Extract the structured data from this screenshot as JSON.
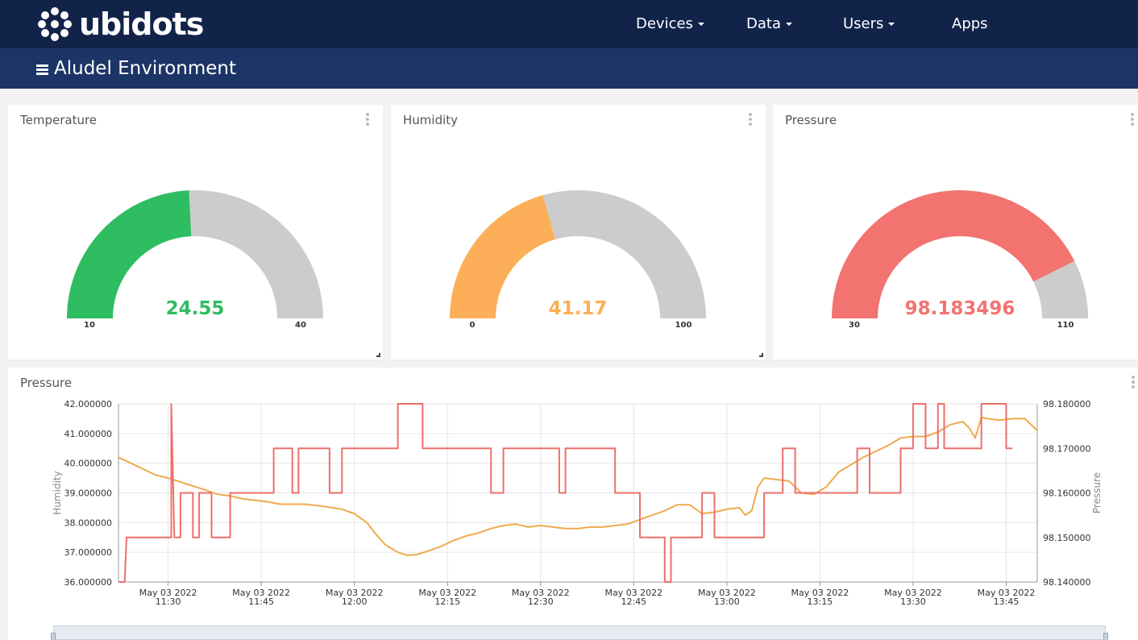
{
  "app": {
    "brand": "ubidots",
    "nav": [
      {
        "label": "Devices",
        "has_menu": true
      },
      {
        "label": "Data",
        "has_menu": true
      },
      {
        "label": "Users",
        "has_menu": true
      },
      {
        "label": "Apps",
        "has_menu": false
      }
    ],
    "dashboard_title": "Aludel Environment"
  },
  "colors": {
    "navbar": "#12234a",
    "subheader": "#1c3566",
    "temperature": "#2ebd60",
    "humidity": "#fcaf58",
    "pressure": "#f27370",
    "gauge_track": "#cccccc"
  },
  "gauges": [
    {
      "title": "Temperature",
      "value": "24.55",
      "value_num": 24.55,
      "min": "10",
      "max": "40",
      "min_num": 10,
      "max_num": 40,
      "color": "#2ebd60"
    },
    {
      "title": "Humidity",
      "value": "41.17",
      "value_num": 41.17,
      "min": "0",
      "max": "100",
      "min_num": 0,
      "max_num": 100,
      "color": "#fcaf58"
    },
    {
      "title": "Pressure",
      "value": "98.183496",
      "value_num": 98.183496,
      "min": "30",
      "max": "110",
      "min_num": 30,
      "max_num": 110,
      "color": "#f27370"
    }
  ],
  "chart_data": {
    "type": "line",
    "title": "Pressure",
    "ylabel_left": "Humidity",
    "ylabel_right": "Pressure",
    "y_left_range": [
      36,
      42
    ],
    "y_right_range": [
      98.14,
      98.18
    ],
    "y_left_ticks": [
      "42.000000",
      "41.000000",
      "40.000000",
      "39.000000",
      "38.000000",
      "37.000000",
      "36.000000"
    ],
    "y_right_ticks": [
      "98.180000",
      "98.170000",
      "98.160000",
      "98.150000",
      "98.140000"
    ],
    "x_range_minutes": [
      682,
      830
    ],
    "x_ticks": [
      {
        "date": "May 03 2022",
        "time": "11:30",
        "minutes": 690
      },
      {
        "date": "May 03 2022",
        "time": "11:45",
        "minutes": 705
      },
      {
        "date": "May 03 2022",
        "time": "12:00",
        "minutes": 720
      },
      {
        "date": "May 03 2022",
        "time": "12:15",
        "minutes": 735
      },
      {
        "date": "May 03 2022",
        "time": "12:30",
        "minutes": 750
      },
      {
        "date": "May 03 2022",
        "time": "12:45",
        "minutes": 765
      },
      {
        "date": "May 03 2022",
        "time": "13:00",
        "minutes": 780
      },
      {
        "date": "May 03 2022",
        "time": "13:15",
        "minutes": 795
      },
      {
        "date": "May 03 2022",
        "time": "13:30",
        "minutes": 810
      },
      {
        "date": "May 03 2022",
        "time": "13:45",
        "minutes": 825
      }
    ],
    "grid": true,
    "series": [
      {
        "name": "Humidity",
        "axis": "left",
        "color": "#f0a94e",
        "points": [
          [
            682,
            40.2
          ],
          [
            684,
            40.0
          ],
          [
            686,
            39.8
          ],
          [
            688,
            39.6
          ],
          [
            690,
            39.5
          ],
          [
            693,
            39.3
          ],
          [
            696,
            39.1
          ],
          [
            698,
            38.95
          ],
          [
            700,
            38.9
          ],
          [
            702,
            38.8
          ],
          [
            704,
            38.75
          ],
          [
            706,
            38.7
          ],
          [
            708,
            38.62
          ],
          [
            712,
            38.62
          ],
          [
            715,
            38.55
          ],
          [
            718,
            38.45
          ],
          [
            720,
            38.3
          ],
          [
            722,
            38.0
          ],
          [
            723.5,
            37.6
          ],
          [
            725,
            37.25
          ],
          [
            727,
            37.0
          ],
          [
            728.5,
            36.9
          ],
          [
            730,
            36.92
          ],
          [
            732,
            37.05
          ],
          [
            734,
            37.2
          ],
          [
            736,
            37.4
          ],
          [
            738,
            37.55
          ],
          [
            740,
            37.65
          ],
          [
            742,
            37.8
          ],
          [
            744,
            37.9
          ],
          [
            746,
            37.95
          ],
          [
            748,
            37.85
          ],
          [
            750,
            37.9
          ],
          [
            752,
            37.85
          ],
          [
            754,
            37.8
          ],
          [
            756,
            37.8
          ],
          [
            758,
            37.85
          ],
          [
            760,
            37.85
          ],
          [
            762,
            37.9
          ],
          [
            764,
            37.95
          ],
          [
            766,
            38.1
          ],
          [
            768,
            38.25
          ],
          [
            770,
            38.4
          ],
          [
            772,
            38.6
          ],
          [
            774,
            38.6
          ],
          [
            776,
            38.3
          ],
          [
            778,
            38.35
          ],
          [
            780,
            38.45
          ],
          [
            782,
            38.5
          ],
          [
            783,
            38.25
          ],
          [
            784,
            38.4
          ],
          [
            785,
            39.2
          ],
          [
            786,
            39.5
          ],
          [
            788,
            39.45
          ],
          [
            790,
            39.4
          ],
          [
            792,
            39.0
          ],
          [
            794,
            38.95
          ],
          [
            796,
            39.2
          ],
          [
            798,
            39.7
          ],
          [
            800,
            39.95
          ],
          [
            802,
            40.2
          ],
          [
            804,
            40.4
          ],
          [
            806,
            40.6
          ],
          [
            808,
            40.85
          ],
          [
            810,
            40.9
          ],
          [
            812,
            40.9
          ],
          [
            814,
            41.05
          ],
          [
            816,
            41.3
          ],
          [
            818,
            41.4
          ],
          [
            819,
            41.2
          ],
          [
            820,
            40.85
          ],
          [
            821,
            41.55
          ],
          [
            822,
            41.5
          ],
          [
            824,
            41.45
          ],
          [
            826,
            41.5
          ],
          [
            828,
            41.5
          ],
          [
            830,
            41.1
          ]
        ]
      },
      {
        "name": "Pressure",
        "axis": "right",
        "color": "#ec6f6b",
        "points": [
          [
            682,
            98.14
          ],
          [
            683,
            98.14
          ],
          [
            683.3,
            98.15
          ],
          [
            690.5,
            98.15
          ],
          [
            690.5,
            98.18
          ],
          [
            691,
            98.15
          ],
          [
            692,
            98.15
          ],
          [
            692,
            98.16
          ],
          [
            694,
            98.16
          ],
          [
            694,
            98.15
          ],
          [
            695,
            98.15
          ],
          [
            695,
            98.16
          ],
          [
            697,
            98.16
          ],
          [
            697,
            98.15
          ],
          [
            700,
            98.15
          ],
          [
            700,
            98.16
          ],
          [
            707,
            98.16
          ],
          [
            707,
            98.17
          ],
          [
            710,
            98.17
          ],
          [
            710,
            98.16
          ],
          [
            711,
            98.16
          ],
          [
            711,
            98.17
          ],
          [
            716,
            98.17
          ],
          [
            716,
            98.16
          ],
          [
            718,
            98.16
          ],
          [
            718,
            98.17
          ],
          [
            727,
            98.17
          ],
          [
            727,
            98.18
          ],
          [
            731,
            98.18
          ],
          [
            731,
            98.17
          ],
          [
            742,
            98.17
          ],
          [
            742,
            98.16
          ],
          [
            744,
            98.16
          ],
          [
            744,
            98.17
          ],
          [
            753,
            98.17
          ],
          [
            753,
            98.16
          ],
          [
            754,
            98.16
          ],
          [
            754,
            98.17
          ],
          [
            762,
            98.17
          ],
          [
            762,
            98.16
          ],
          [
            766,
            98.16
          ],
          [
            766,
            98.15
          ],
          [
            770,
            98.15
          ],
          [
            770,
            98.14
          ],
          [
            771,
            98.14
          ],
          [
            771,
            98.15
          ],
          [
            776,
            98.15
          ],
          [
            776,
            98.16
          ],
          [
            778,
            98.16
          ],
          [
            778,
            98.15
          ],
          [
            786,
            98.15
          ],
          [
            786,
            98.16
          ],
          [
            789,
            98.16
          ],
          [
            789,
            98.17
          ],
          [
            791,
            98.17
          ],
          [
            791,
            98.16
          ],
          [
            801,
            98.16
          ],
          [
            801,
            98.17
          ],
          [
            803,
            98.17
          ],
          [
            803,
            98.16
          ],
          [
            808,
            98.16
          ],
          [
            808,
            98.17
          ],
          [
            810,
            98.17
          ],
          [
            810,
            98.18
          ],
          [
            812,
            98.18
          ],
          [
            812,
            98.17
          ],
          [
            814,
            98.17
          ],
          [
            814,
            98.18
          ],
          [
            815,
            98.18
          ],
          [
            815,
            98.17
          ],
          [
            821,
            98.17
          ],
          [
            821,
            98.18
          ],
          [
            825,
            98.18
          ],
          [
            825,
            98.17
          ],
          [
            826,
            98.17
          ]
        ]
      }
    ]
  },
  "chart_title": "Pressure"
}
